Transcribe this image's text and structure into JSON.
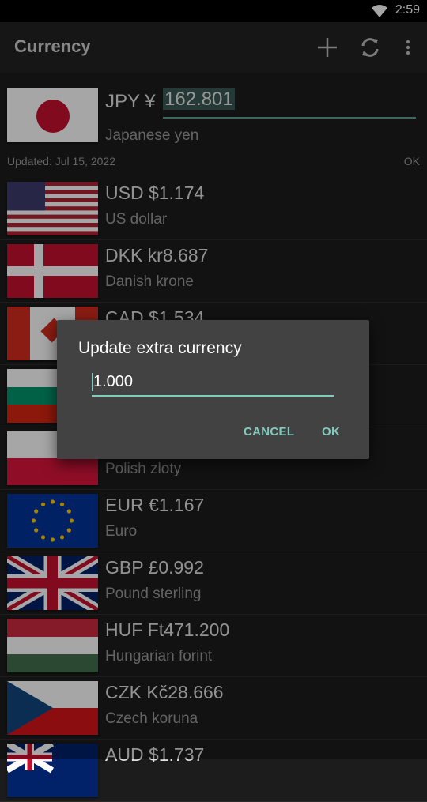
{
  "status": {
    "time": "2:59"
  },
  "appbar": {
    "title": "Currency",
    "icons": [
      "add-icon",
      "refresh-icon",
      "overflow-menu-icon"
    ]
  },
  "base": {
    "code_symbol": "JPY ¥",
    "amount": "162.801",
    "name": "Japanese yen"
  },
  "updated": {
    "text": "Updated: Jul 15, 2022",
    "status": "OK"
  },
  "rows": [
    {
      "code": "USD $1.174",
      "name": "US dollar",
      "flag": "us"
    },
    {
      "code": "DKK kr8.687",
      "name": "Danish krone",
      "flag": "dk"
    },
    {
      "code": "CAD $1.534",
      "name": "",
      "flag": "ca"
    },
    {
      "code": "",
      "name": "",
      "flag": "bg"
    },
    {
      "code": "",
      "name": "Polish zloty",
      "flag": "pl"
    },
    {
      "code": "EUR €1.167",
      "name": "Euro",
      "flag": "eu"
    },
    {
      "code": "GBP £0.992",
      "name": "Pound sterling",
      "flag": "gb"
    },
    {
      "code": "HUF Ft471.200",
      "name": "Hungarian forint",
      "flag": "hu"
    },
    {
      "code": "CZK Kč28.666",
      "name": "Czech koruna",
      "flag": "cz"
    },
    {
      "code": "AUD $1.737",
      "name": "",
      "flag": "au"
    }
  ],
  "dialog": {
    "title": "Update extra currency",
    "value": "1.000",
    "cancel": "CANCEL",
    "ok": "OK"
  },
  "colors": {
    "accent": "#7fcbbd",
    "dialog_bg": "#424242",
    "background": "#1c1c1c"
  }
}
